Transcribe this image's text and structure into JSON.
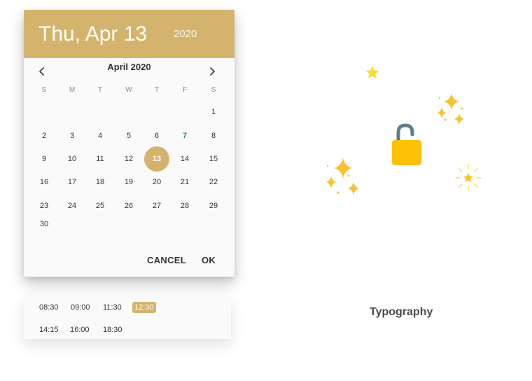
{
  "header": {
    "date": "Thu, Apr 13",
    "year": "2020"
  },
  "calendar": {
    "month_title": "April 2020",
    "weekdays": [
      "S",
      "M",
      "T",
      "W",
      "T",
      "F",
      "S"
    ],
    "weeks": [
      [
        "",
        "",
        "",
        "",
        "",
        "",
        "1"
      ],
      [
        "2",
        "3",
        "4",
        "5",
        "6",
        "7",
        "8"
      ],
      [
        "9",
        "10",
        "11",
        "12",
        "13",
        "14",
        "15"
      ],
      [
        "16",
        "17",
        "18",
        "19",
        "20",
        "21",
        "22"
      ],
      [
        "23",
        "24",
        "25",
        "26",
        "27",
        "28",
        "29"
      ],
      [
        "30",
        "",
        "",
        "",
        "",
        "",
        ""
      ]
    ],
    "today": "7",
    "selected": "13"
  },
  "actions": {
    "cancel": "CANCEL",
    "ok": "OK"
  },
  "times": {
    "row1": [
      "08:30",
      "09:00",
      "11:30",
      "12:30"
    ],
    "row2": [
      "14:15",
      "16:00",
      "18:30"
    ],
    "selected": "12:30"
  },
  "colors": {
    "accent": "#d4b46d",
    "today": "#1e9187",
    "lock": "#ffc107",
    "shackle": "#607d8b",
    "sparkle": "#fdd835"
  },
  "illustration": {
    "icons": [
      "star-icon",
      "sparkles-icon",
      "lock-icon",
      "sparkles-icon",
      "glitter-star-icon"
    ]
  },
  "footer": {
    "label": "Typography"
  }
}
